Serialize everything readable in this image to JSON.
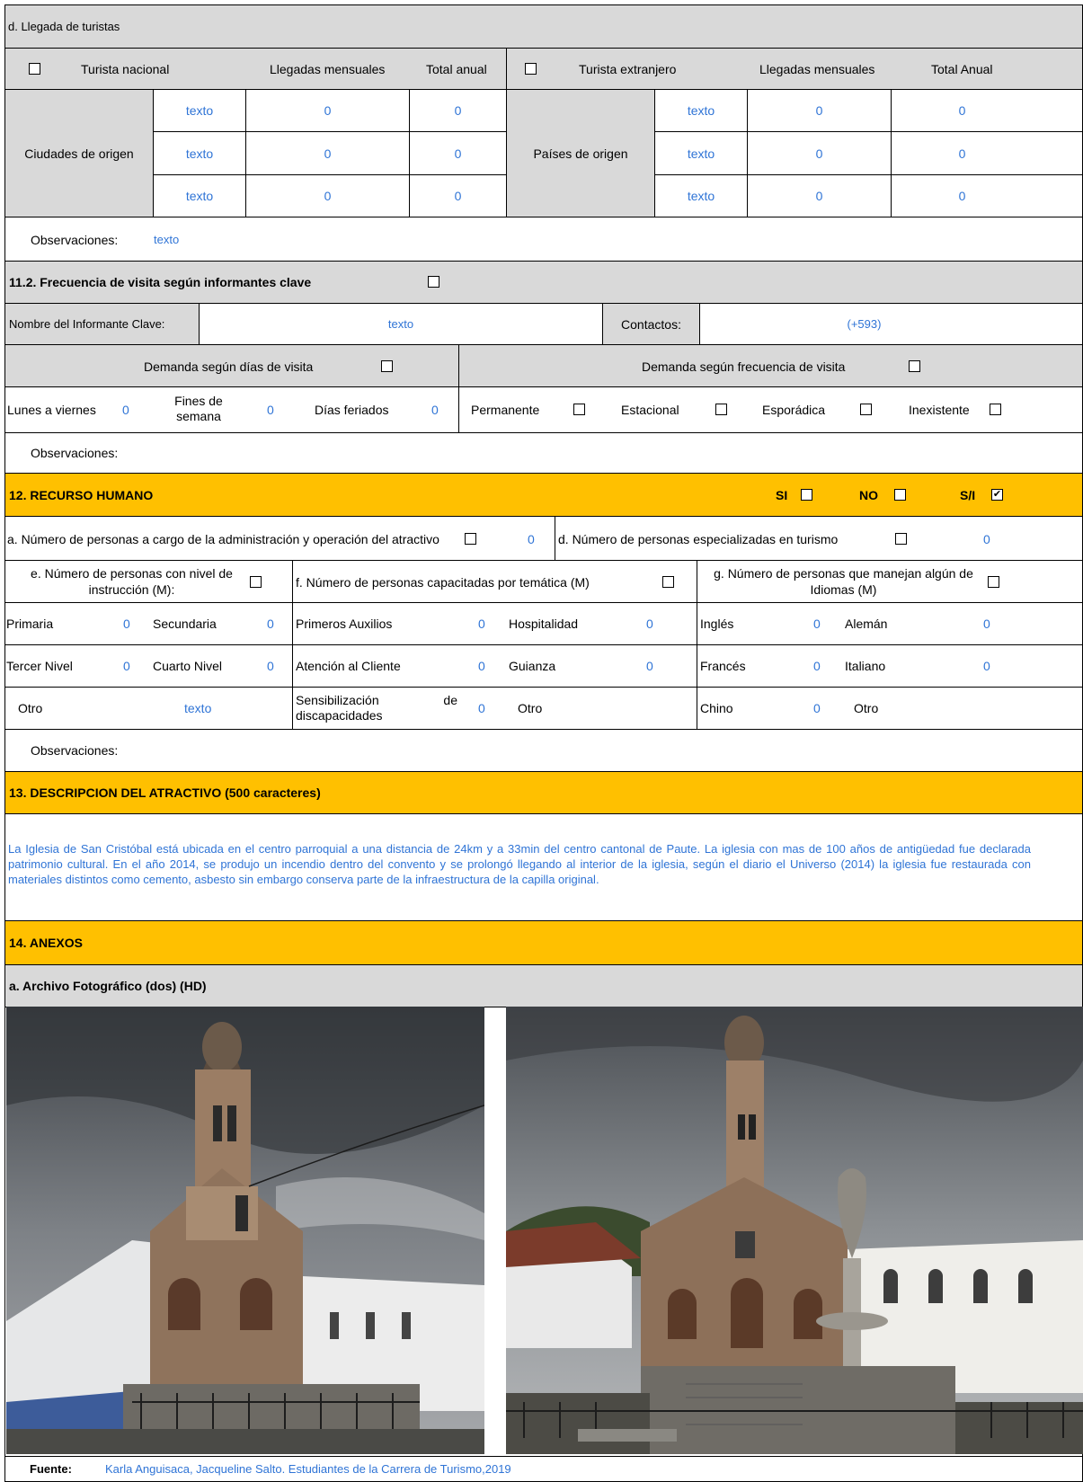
{
  "llegada": {
    "title": "d. Llegada de turistas",
    "nacional_label": "Turista nacional",
    "llegadas_mensuales": "Llegadas mensuales",
    "total_anual": "Total anual",
    "extranjero_label": "Turista extranjero",
    "llegadas_mensuales_2": "Llegadas mensuales",
    "total_anual_2": "Total Anual",
    "ciudades_label": "Ciudades de origen",
    "paises_label": "Países de origen",
    "ciudades_rows": [
      {
        "nombre": "texto",
        "mensual": "0",
        "anual": "0"
      },
      {
        "nombre": "texto",
        "mensual": "0",
        "anual": "0"
      },
      {
        "nombre": "texto",
        "mensual": "0",
        "anual": "0"
      }
    ],
    "paises_rows": [
      {
        "nombre": "texto",
        "mensual": "0",
        "anual": "0"
      },
      {
        "nombre": "texto",
        "mensual": "0",
        "anual": "0"
      },
      {
        "nombre": "texto",
        "mensual": "0",
        "anual": "0"
      }
    ],
    "obs_label": "Observaciones:",
    "obs_value": "texto"
  },
  "frecuencia": {
    "title": "11.2. Frecuencia de visita según informantes clave",
    "informante_label": "Nombre del Informante Clave:",
    "informante_value": "texto",
    "contactos_label": "Contactos:",
    "contactos_value": "(+593)",
    "dias_header": "Demanda según  días de visita",
    "freq_header": "Demanda según frecuencia de visita",
    "lunes_label": "Lunes a viernes",
    "lunes_value": "0",
    "fines_label": "Fines de semana",
    "fines_value": "0",
    "feriados_label": "Días feriados",
    "feriados_value": "0",
    "permanente": "Permanente",
    "estacional": "Estacional",
    "esporadica": "Esporádica",
    "inexistente": "Inexistente",
    "obs_label": "Observaciones:"
  },
  "recurso": {
    "title": "12. RECURSO HUMANO",
    "si": "SI",
    "no": "NO",
    "sn": "S/I",
    "a_label": "a. Número de personas a cargo de la administración y operación del atractivo",
    "a_value": "0",
    "d_label": "d. Número de personas especializadas en turismo",
    "d_value": "0",
    "e_label": "e. Número de personas con nivel de instrucción (M):",
    "f_label": "f. Número de personas capacitadas por temática (M)",
    "g_label": "g. Número de personas que manejan algún de Idiomas (M)",
    "primaria": "Primaria",
    "primaria_v": "0",
    "secundaria": "Secundaria",
    "secundaria_v": "0",
    "tercer": "Tercer Nivel",
    "tercer_v": "0",
    "cuarto": "Cuarto Nivel",
    "cuarto_v": "0",
    "otro_e": "Otro",
    "otro_e_v": "texto",
    "auxilios": "Primeros Auxilios",
    "auxilios_v": "0",
    "hospitalidad": "Hospitalidad",
    "hospitalidad_v": "0",
    "atencion": "Atención al Cliente",
    "atencion_v": "0",
    "guianza": "Guianza",
    "guianza_v": "0",
    "sensib": "Sensibilización de discapacidades",
    "sensib_v": "0",
    "otro_f": "Otro",
    "ingles": "Inglés",
    "ingles_v": "0",
    "aleman": "Alemán",
    "aleman_v": "0",
    "frances": "Francés",
    "frances_v": "0",
    "italiano": "Italiano",
    "italiano_v": "0",
    "chino": "Chino",
    "chino_v": "0",
    "otro_g": "Otro",
    "obs_label": "Observaciones:"
  },
  "descripcion": {
    "title": "13. DESCRIPCION DEL ATRACTIVO (500 caracteres)",
    "text": "La Iglesia de San Cristóbal está ubicada en el centro parroquial a una distancia de 24km y a 33min del centro cantonal de Paute. La iglesia con mas de 100 años de antigüedad fue declarada patrimonio cultural. En el año 2014, se produjo un incendio dentro del convento y se prolongó llegando al interior de la iglesia, según el diario el Universo (2014) la iglesia fue restaurada con materiales distintos como cemento, asbesto sin embargo conserva parte de la infraestructura de la capilla original."
  },
  "anexos": {
    "title": "14. ANEXOS",
    "archivo": "a. Archivo Fotográfico (dos) (HD)",
    "fuente_label": "Fuente:",
    "fuente_value": "Karla Anguisaca, Jacqueline Salto. Estudiantes de la Carrera de Turismo,2019"
  },
  "colors": {
    "header_gray": "#d9d9d9",
    "section_gold": "#ffc000",
    "value_blue": "#2f74d6"
  }
}
